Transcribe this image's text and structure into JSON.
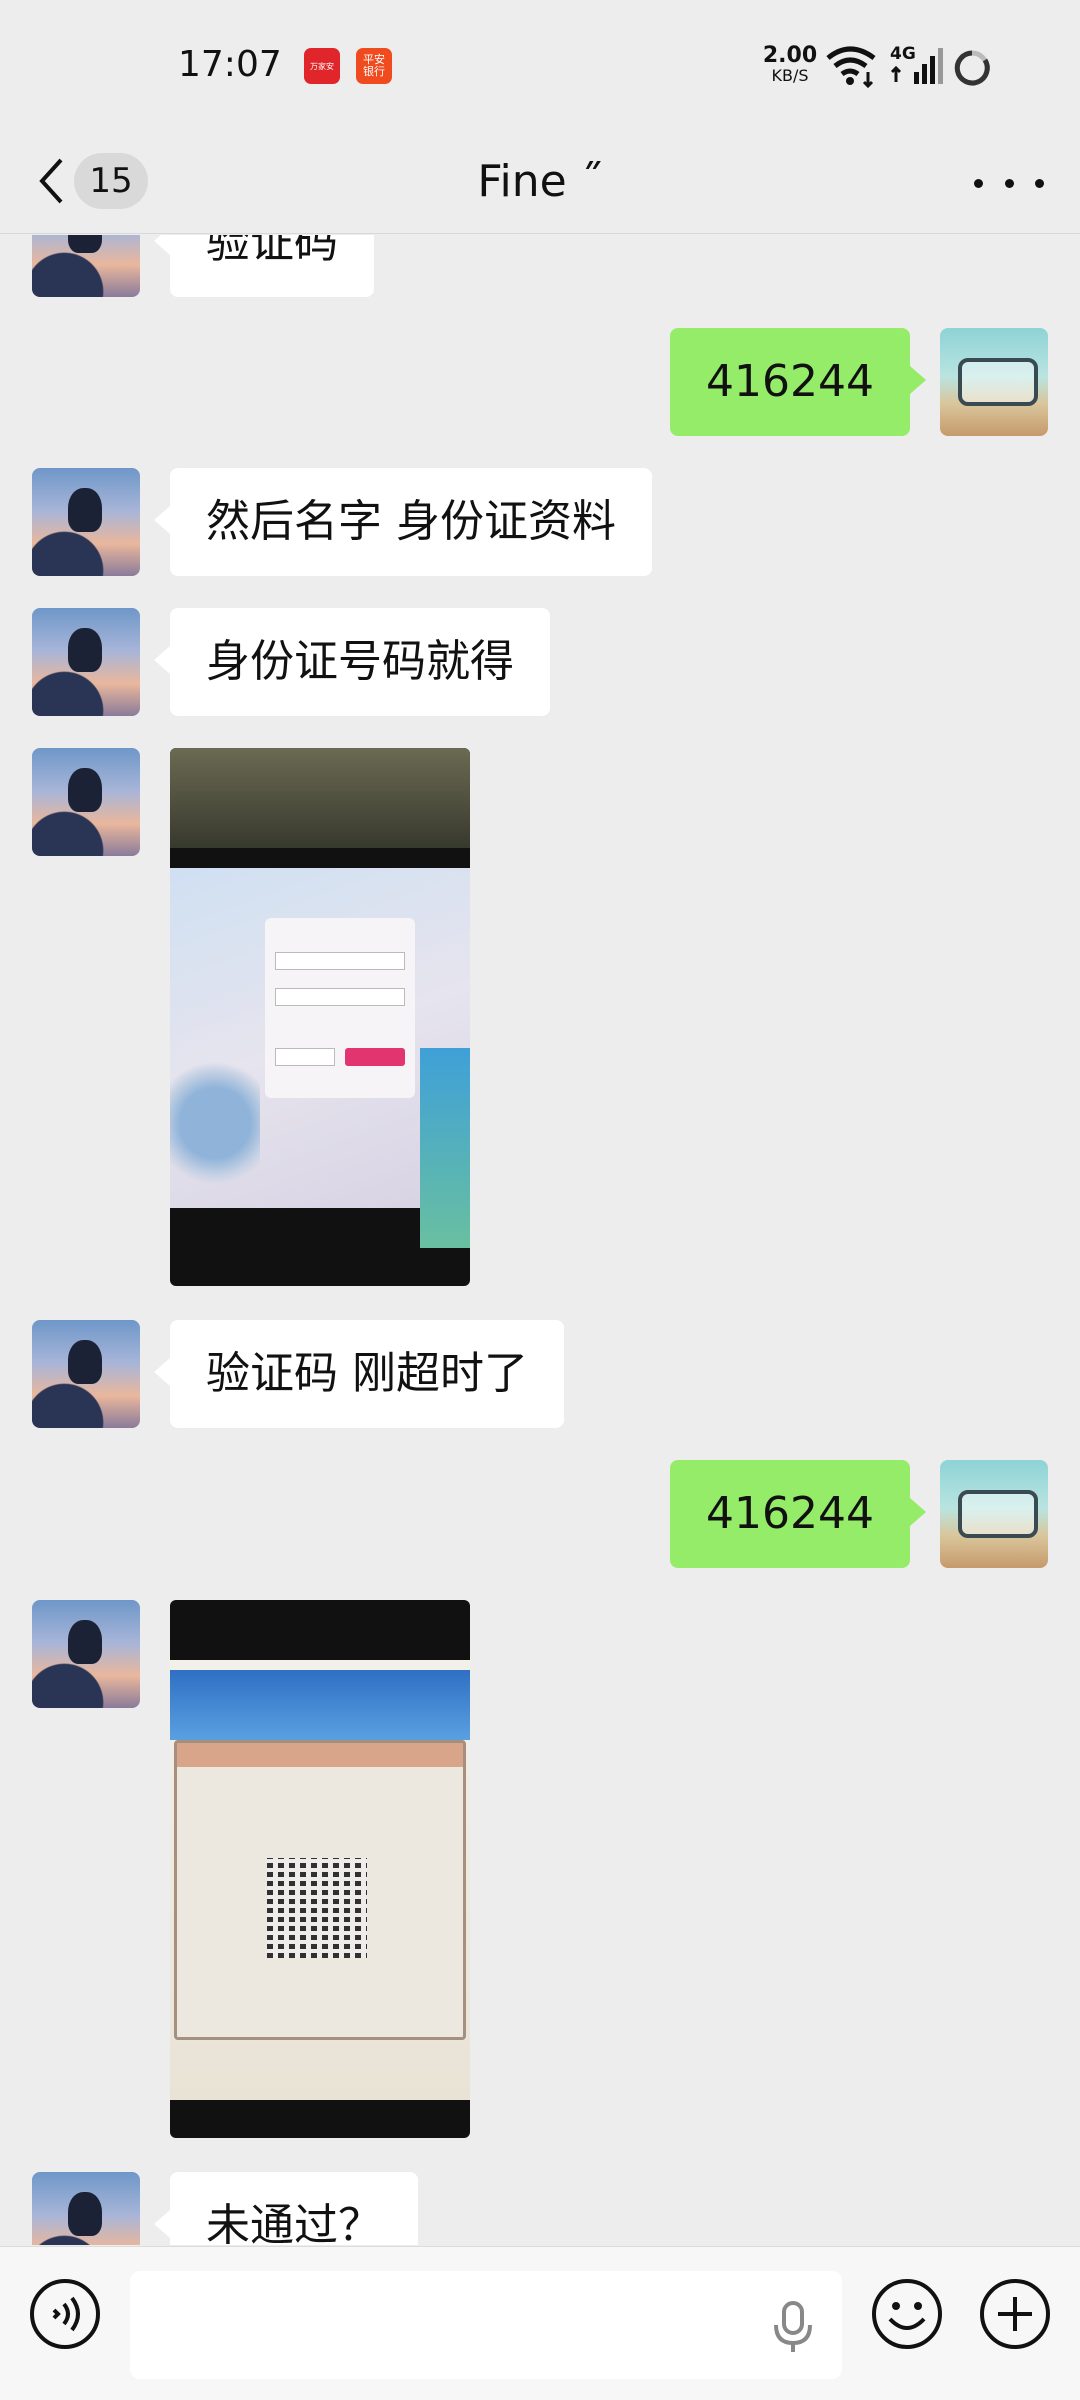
{
  "status_bar": {
    "time": "17:07",
    "notification_icons": [
      {
        "name": "app-notification-icon",
        "text": "万家安"
      },
      {
        "name": "pingan-bank-icon",
        "text": "平安银行"
      }
    ],
    "net_speed_value": "2.00",
    "net_speed_unit": "KB/S",
    "network_type": "4G"
  },
  "header": {
    "unread_count": "15",
    "title": "Fine ˝"
  },
  "messages": [
    {
      "side": "peer",
      "type": "text",
      "text": "验证码"
    },
    {
      "side": "self",
      "type": "text",
      "text": "416244"
    },
    {
      "side": "peer",
      "type": "text",
      "text": "然后名字  身份证资料"
    },
    {
      "side": "peer",
      "type": "text",
      "text": "身份证号码就得"
    },
    {
      "side": "peer",
      "type": "image",
      "description": "photo-login-screen"
    },
    {
      "side": "peer",
      "type": "text",
      "text": "验证码  刚超时了"
    },
    {
      "side": "self",
      "type": "text",
      "text": "416244"
    },
    {
      "side": "peer",
      "type": "image",
      "description": "photo-qr-verification"
    },
    {
      "side": "peer",
      "type": "text",
      "text": "未通过？"
    }
  ],
  "input_bar": {
    "value": "",
    "placeholder": ""
  },
  "colors": {
    "background": "#ededed",
    "self_bubble": "#95ec69",
    "peer_bubble": "#ffffff"
  }
}
